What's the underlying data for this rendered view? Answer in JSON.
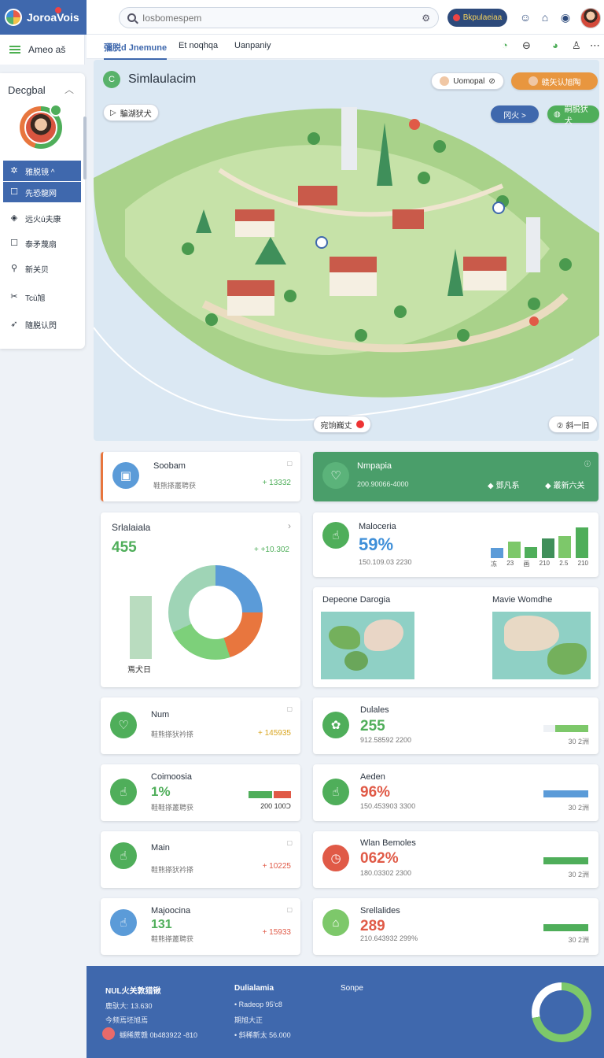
{
  "app": {
    "name": "JoroaVois"
  },
  "search": {
    "placeholder": "Iosbomespem"
  },
  "header": {
    "action_label": "Bkpulaeiaa"
  },
  "sidebar": {
    "menu_label": "Ameo aš",
    "panel_title": "Decgbal",
    "items": [
      {
        "label": "雅脱镜 ^",
        "icon": "grid-icon"
      },
      {
        "label": "先恐龍网",
        "icon": "square-icon"
      },
      {
        "label": "远火ú夫康",
        "icon": "shield-icon"
      },
      {
        "label": "泰矛蔑扇",
        "icon": "box-icon"
      },
      {
        "label": "新关贝",
        "icon": "search-icon"
      },
      {
        "label": "Tcù旭",
        "icon": "tools-icon"
      },
      {
        "label": "隨脱认閃",
        "icon": "send-icon"
      }
    ]
  },
  "tabs": [
    {
      "label": "彌脱d Jnemune"
    },
    {
      "label": "Et noqhqa"
    },
    {
      "label": "Uanpaniy"
    }
  ],
  "map": {
    "title": "Simlaulacim",
    "left_chip": "騙湖犾犬",
    "chip_user": "Uomopal",
    "chip_orange": "赣矢认旭陶",
    "chip_blue": "冈火 >",
    "chip_green": "嗣脱犾犬",
    "bottom_chip": "宛饷巍丈",
    "bottom_right_chip": "② 斜一旧"
  },
  "cards": {
    "soobam": {
      "title": "Soobam",
      "sub": "鞋熊搽叢聘获",
      "delta": "+ 13332"
    },
    "nmpapia": {
      "title": "Nmpapia",
      "sub": "200.90066-4000",
      "a": "◆ 鄧凡系",
      "b": "◆ 叢新六关",
      "corner": "ⓘ"
    },
    "stats": {
      "title": "Srlalaiala",
      "big": "455",
      "delta": "+ +10.302",
      "bar_label": "焉犬日"
    },
    "malocria": {
      "title": "Maloceria",
      "big": "59%",
      "sub": "150.109.03 2230",
      "labels": [
        "冻",
        "23",
        "画",
        "210",
        "2.5",
        "210"
      ]
    },
    "maps": {
      "left_title": "Depeone Darogia",
      "right_title": "Mavie Womdhe"
    },
    "num": {
      "title": "Num",
      "sub": "鞋熊搽犾衿搽",
      "delta": "+ 145935"
    },
    "dulales": {
      "title": "Dulales",
      "big": "255",
      "sub": "912.58592 2200",
      "right": "30 2洲"
    },
    "coimosia": {
      "title": "Coimoosia",
      "big": "1%",
      "sub": "鞋鞋搽叢聘获",
      "right": "200 100Ↄ"
    },
    "aeden": {
      "title": "Aeden",
      "big": "96%",
      "sub": "150.453903 3300",
      "right": "30 2洲"
    },
    "main": {
      "title": "Main",
      "sub": "鞋熊搽犾衿搽",
      "delta": "+ 10225"
    },
    "wlan": {
      "title": "Wlan Bemoles",
      "big": "062%",
      "sub": "180.03302 2300",
      "right": "30 2洲"
    },
    "majo": {
      "title": "Majoocina",
      "big": "131",
      "sub": "鞋熊搽叢聘获",
      "delta": "+ 15933"
    },
    "srelal": {
      "title": "Srellalides",
      "big": "289",
      "sub": "210.643932 299%",
      "right": "30 2洲"
    }
  },
  "bars": {
    "malocria": [
      0.25,
      0.42,
      0.28,
      0.5,
      0.55,
      0.78
    ]
  },
  "footer": {
    "col1_title": "NUL火关敦猎锹",
    "col1_line1": "鹿驮大: 13.630",
    "col1_line2": "今频焉坯旭焉",
    "col1_line3": "蝴稀蔗赣 0b483922 -810",
    "col2_title": "Dulialamia",
    "col2_line1": "• Radeop    95'c8",
    "col2_line2": "期旭大正",
    "col2_line3": "• 斜稀新太 56.000",
    "col3_title": "Sonpe",
    "ring_fraction": 0.72
  },
  "colors": {
    "primary": "#3f68ad",
    "green": "#4fae5a",
    "orange": "#e8763e",
    "red": "#e05a47",
    "blue": "#5b9bd8"
  }
}
